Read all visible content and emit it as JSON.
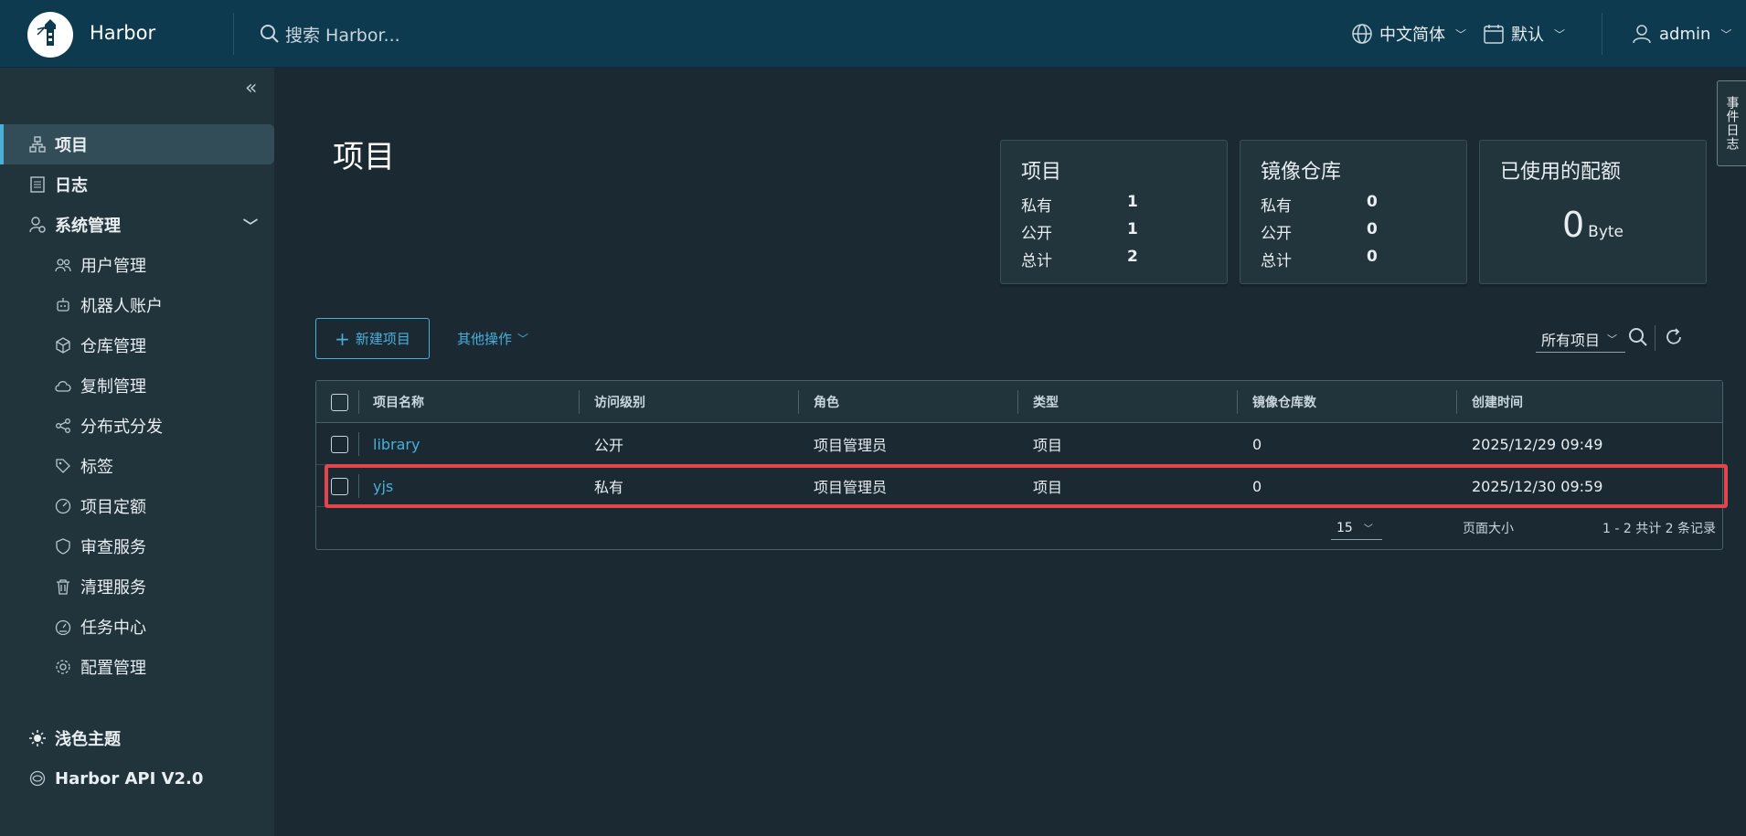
{
  "header": {
    "brand": "Harbor",
    "search_placeholder": "搜索 Harbor...",
    "language": "中文简体",
    "theme_default": "默认",
    "user": "admin"
  },
  "sidebar": {
    "items": [
      {
        "label": "项目",
        "icon": "project-icon",
        "active": true
      },
      {
        "label": "日志",
        "icon": "log-icon"
      },
      {
        "label": "系统管理",
        "icon": "system-admin-icon"
      },
      {
        "label": "用户管理",
        "icon": "users-icon"
      },
      {
        "label": "机器人账户",
        "icon": "robot-icon"
      },
      {
        "label": "仓库管理",
        "icon": "registry-icon"
      },
      {
        "label": "复制管理",
        "icon": "replication-icon"
      },
      {
        "label": "分布式分发",
        "icon": "share-icon"
      },
      {
        "label": "标签",
        "icon": "tag-icon"
      },
      {
        "label": "项目定额",
        "icon": "quota-icon"
      },
      {
        "label": "审查服务",
        "icon": "shield-icon"
      },
      {
        "label": "清理服务",
        "icon": "trash-icon"
      },
      {
        "label": "任务中心",
        "icon": "dashboard-icon"
      },
      {
        "label": "配置管理",
        "icon": "gear-icon"
      }
    ],
    "bottom": [
      {
        "label": "浅色主题",
        "icon": "sun-icon"
      },
      {
        "label": "Harbor API V2.0",
        "icon": "api-icon"
      }
    ]
  },
  "main": {
    "title": "项目",
    "cards": [
      {
        "title": "项目",
        "rows": [
          {
            "label": "私有",
            "value": "1"
          },
          {
            "label": "公开",
            "value": "1"
          },
          {
            "label": "总计",
            "value": "2"
          }
        ]
      },
      {
        "title": "镜像仓库",
        "rows": [
          {
            "label": "私有",
            "value": "0"
          },
          {
            "label": "公开",
            "value": "0"
          },
          {
            "label": "总计",
            "value": "0"
          }
        ]
      },
      {
        "title": "已使用的配额",
        "value": "0",
        "unit": "Byte"
      }
    ],
    "new_project": "新建项目",
    "other_actions": "其他操作",
    "filter": "所有项目",
    "table": {
      "columns": [
        "项目名称",
        "访问级别",
        "角色",
        "类型",
        "镜像仓库数",
        "创建时间"
      ],
      "rows": [
        {
          "name": "library",
          "access": "公开",
          "role": "项目管理员",
          "type": "项目",
          "repos": "0",
          "created": "2025/12/29 09:49"
        },
        {
          "name": "yjs",
          "access": "私有",
          "role": "项目管理员",
          "type": "项目",
          "repos": "0",
          "created": "2025/12/30 09:59"
        }
      ],
      "page_size_label": "页面大小",
      "page_size": "15",
      "summary": "1 - 2 共计 2 条记录"
    },
    "event_log": "事件日志",
    "highlight_color": "#e4454d",
    "accent_color": "#49afd9"
  }
}
